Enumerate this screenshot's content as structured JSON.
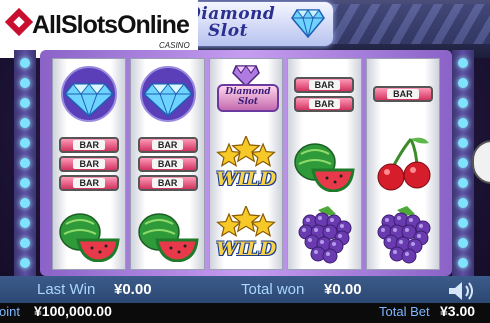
{
  "game": {
    "title_line1": "Diamond",
    "title_line2": "Slot"
  },
  "watermark": {
    "brand": "AllSlotsOnline",
    "sub": "CASINO"
  },
  "reels": [
    [
      "diamond",
      "bar-3",
      "watermelon"
    ],
    [
      "diamond",
      "bar-3",
      "watermelon"
    ],
    [
      "diamond-slot-logo",
      "wild",
      "wild"
    ],
    [
      "bar-2",
      "watermelon",
      "grapes"
    ],
    [
      "bar-1",
      "cherries",
      "grapes"
    ]
  ],
  "symbols": {
    "bar_label": "BAR",
    "wild_label": "WILD",
    "logo_line1": "Diamond",
    "logo_line2": "Slot"
  },
  "status": {
    "last_win_label": "Last Win",
    "last_win_value": "¥0.00",
    "total_won_label": "Total won",
    "total_won_value": "¥0.00"
  },
  "footer": {
    "point_label": "oint",
    "point_value": "¥100,000.00",
    "total_bet_label": "Total Bet",
    "total_bet_value": "¥3.00"
  },
  "icons": {
    "sound": "speaker-icon",
    "gem": "diamond-icon"
  }
}
